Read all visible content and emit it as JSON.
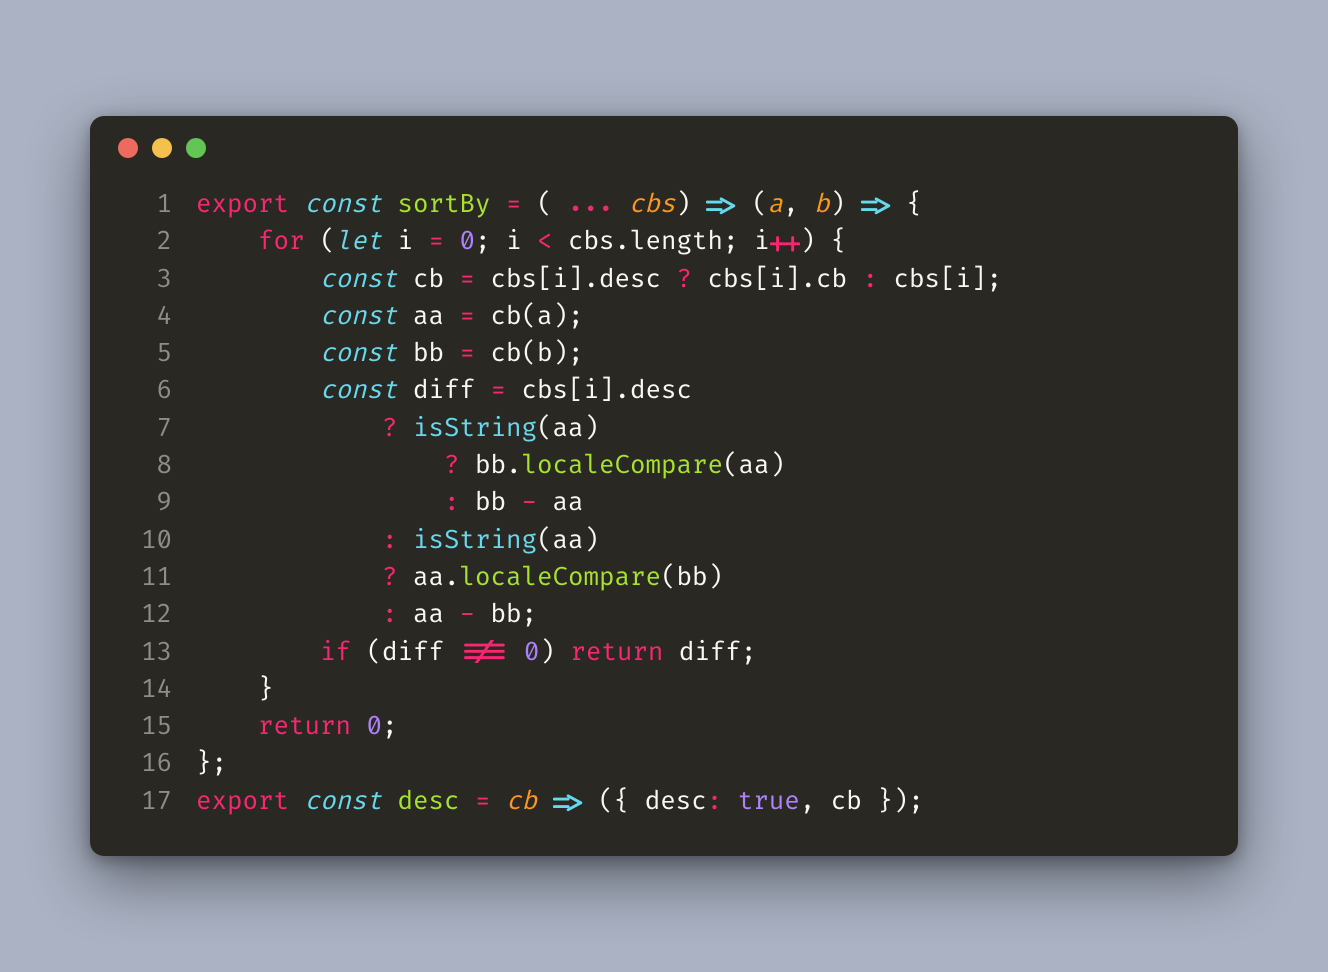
{
  "colors": {
    "page_bg": "#aab2c3",
    "window_bg": "#2a2822",
    "gutter": "#8d8f87",
    "text": "#f9f8f5",
    "keyword": "#f92672",
    "decl": "#66d9ef",
    "ident_decl": "#a6e22e",
    "param": "#fd971f",
    "number": "#ae81ff",
    "method": "#a6e22e",
    "dot_red": "#ed6a5e",
    "dot_yellow": "#f5c04e",
    "dot_green": "#62c554"
  },
  "code": {
    "lines": [
      {
        "n": "1",
        "indent": 0,
        "tokens": [
          [
            "kw-export",
            "export"
          ],
          [
            "sp",
            " "
          ],
          [
            "kw-decl",
            "const"
          ],
          [
            "sp",
            " "
          ],
          [
            "ident-decl",
            "sortBy"
          ],
          [
            "sp",
            " "
          ],
          [
            "op-main",
            "="
          ],
          [
            "sp",
            " "
          ],
          [
            "punct",
            "("
          ],
          [
            "sp",
            " "
          ],
          [
            "spread"
          ],
          [
            "sp",
            " "
          ],
          [
            "param",
            "cbs"
          ],
          [
            "punct",
            ")"
          ],
          [
            "sp",
            " "
          ],
          [
            "arrow"
          ],
          [
            "sp",
            " "
          ],
          [
            "punct",
            "("
          ],
          [
            "param",
            "a"
          ],
          [
            "punct",
            ","
          ],
          [
            "sp",
            " "
          ],
          [
            "param",
            "b"
          ],
          [
            "punct",
            ")"
          ],
          [
            "sp",
            " "
          ],
          [
            "arrow"
          ],
          [
            "sp",
            " "
          ],
          [
            "punct",
            "{"
          ]
        ]
      },
      {
        "n": "2",
        "indent": 1,
        "tokens": [
          [
            "kw-export",
            "for"
          ],
          [
            "sp",
            " "
          ],
          [
            "punct",
            "("
          ],
          [
            "kw-decl",
            "let"
          ],
          [
            "sp",
            " "
          ],
          [
            "var",
            "i"
          ],
          [
            "sp",
            " "
          ],
          [
            "op-main",
            "="
          ],
          [
            "sp",
            " "
          ],
          [
            "num",
            "0"
          ],
          [
            "punct",
            ";"
          ],
          [
            "sp",
            " "
          ],
          [
            "var",
            "i"
          ],
          [
            "sp",
            " "
          ],
          [
            "op-main",
            "<"
          ],
          [
            "sp",
            " "
          ],
          [
            "var",
            "cbs"
          ],
          [
            "punct",
            "."
          ],
          [
            "var",
            "length"
          ],
          [
            "punct",
            ";"
          ],
          [
            "sp",
            " "
          ],
          [
            "var",
            "i"
          ],
          [
            "pp"
          ],
          [
            "punct",
            ")"
          ],
          [
            "sp",
            " "
          ],
          [
            "punct",
            "{"
          ]
        ]
      },
      {
        "n": "3",
        "indent": 2,
        "tokens": [
          [
            "kw-decl",
            "const"
          ],
          [
            "sp",
            " "
          ],
          [
            "var",
            "cb"
          ],
          [
            "sp",
            " "
          ],
          [
            "op-main",
            "="
          ],
          [
            "sp",
            " "
          ],
          [
            "var",
            "cbs"
          ],
          [
            "punct",
            "["
          ],
          [
            "var",
            "i"
          ],
          [
            "punct",
            "]"
          ],
          [
            "punct",
            "."
          ],
          [
            "var",
            "desc"
          ],
          [
            "sp",
            " "
          ],
          [
            "op-main",
            "?"
          ],
          [
            "sp",
            " "
          ],
          [
            "var",
            "cbs"
          ],
          [
            "punct",
            "["
          ],
          [
            "var",
            "i"
          ],
          [
            "punct",
            "]"
          ],
          [
            "punct",
            "."
          ],
          [
            "var",
            "cb"
          ],
          [
            "sp",
            " "
          ],
          [
            "op-main",
            ":"
          ],
          [
            "sp",
            " "
          ],
          [
            "var",
            "cbs"
          ],
          [
            "punct",
            "["
          ],
          [
            "var",
            "i"
          ],
          [
            "punct",
            "]"
          ],
          [
            "punct",
            ";"
          ]
        ]
      },
      {
        "n": "4",
        "indent": 2,
        "tokens": [
          [
            "kw-decl",
            "const"
          ],
          [
            "sp",
            " "
          ],
          [
            "var",
            "aa"
          ],
          [
            "sp",
            " "
          ],
          [
            "op-main",
            "="
          ],
          [
            "sp",
            " "
          ],
          [
            "var",
            "cb"
          ],
          [
            "punct",
            "("
          ],
          [
            "var",
            "a"
          ],
          [
            "punct",
            ")"
          ],
          [
            "punct",
            ";"
          ]
        ]
      },
      {
        "n": "5",
        "indent": 2,
        "tokens": [
          [
            "kw-decl",
            "const"
          ],
          [
            "sp",
            " "
          ],
          [
            "var",
            "bb"
          ],
          [
            "sp",
            " "
          ],
          [
            "op-main",
            "="
          ],
          [
            "sp",
            " "
          ],
          [
            "var",
            "cb"
          ],
          [
            "punct",
            "("
          ],
          [
            "var",
            "b"
          ],
          [
            "punct",
            ")"
          ],
          [
            "punct",
            ";"
          ]
        ]
      },
      {
        "n": "6",
        "indent": 2,
        "tokens": [
          [
            "kw-decl",
            "const"
          ],
          [
            "sp",
            " "
          ],
          [
            "var",
            "diff"
          ],
          [
            "sp",
            " "
          ],
          [
            "op-main",
            "="
          ],
          [
            "sp",
            " "
          ],
          [
            "var",
            "cbs"
          ],
          [
            "punct",
            "["
          ],
          [
            "var",
            "i"
          ],
          [
            "punct",
            "]"
          ],
          [
            "punct",
            "."
          ],
          [
            "var",
            "desc"
          ]
        ]
      },
      {
        "n": "7",
        "indent": 3,
        "tokens": [
          [
            "op-main",
            "?"
          ],
          [
            "sp",
            " "
          ],
          [
            "call",
            "isString"
          ],
          [
            "punct",
            "("
          ],
          [
            "var",
            "aa"
          ],
          [
            "punct",
            ")"
          ]
        ]
      },
      {
        "n": "8",
        "indent": 4,
        "tokens": [
          [
            "op-main",
            "?"
          ],
          [
            "sp",
            " "
          ],
          [
            "var",
            "bb"
          ],
          [
            "punct",
            "."
          ],
          [
            "method",
            "localeCompare"
          ],
          [
            "punct",
            "("
          ],
          [
            "var",
            "aa"
          ],
          [
            "punct",
            ")"
          ]
        ]
      },
      {
        "n": "9",
        "indent": 4,
        "tokens": [
          [
            "op-main",
            ":"
          ],
          [
            "sp",
            " "
          ],
          [
            "var",
            "bb"
          ],
          [
            "sp",
            " "
          ],
          [
            "op-main",
            "-"
          ],
          [
            "sp",
            " "
          ],
          [
            "var",
            "aa"
          ]
        ]
      },
      {
        "n": "10",
        "indent": 3,
        "tokens": [
          [
            "op-main",
            ":"
          ],
          [
            "sp",
            " "
          ],
          [
            "call",
            "isString"
          ],
          [
            "punct",
            "("
          ],
          [
            "var",
            "aa"
          ],
          [
            "punct",
            ")"
          ]
        ]
      },
      {
        "n": "11",
        "indent": 3,
        "tokens": [
          [
            "op-main",
            "?"
          ],
          [
            "sp",
            " "
          ],
          [
            "var",
            "aa"
          ],
          [
            "punct",
            "."
          ],
          [
            "method",
            "localeCompare"
          ],
          [
            "punct",
            "("
          ],
          [
            "var",
            "bb"
          ],
          [
            "punct",
            ")"
          ]
        ]
      },
      {
        "n": "12",
        "indent": 3,
        "tokens": [
          [
            "op-main",
            ":"
          ],
          [
            "sp",
            " "
          ],
          [
            "var",
            "aa"
          ],
          [
            "sp",
            " "
          ],
          [
            "op-main",
            "-"
          ],
          [
            "sp",
            " "
          ],
          [
            "var",
            "bb"
          ],
          [
            "punct",
            ";"
          ]
        ]
      },
      {
        "n": "13",
        "indent": 2,
        "tokens": [
          [
            "kw-export",
            "if"
          ],
          [
            "sp",
            " "
          ],
          [
            "punct",
            "("
          ],
          [
            "var",
            "diff"
          ],
          [
            "sp",
            " "
          ],
          [
            "neq"
          ],
          [
            "sp",
            " "
          ],
          [
            "num",
            "0"
          ],
          [
            "punct",
            ")"
          ],
          [
            "sp",
            " "
          ],
          [
            "kw-export",
            "return"
          ],
          [
            "sp",
            " "
          ],
          [
            "var",
            "diff"
          ],
          [
            "punct",
            ";"
          ]
        ]
      },
      {
        "n": "14",
        "indent": 1,
        "tokens": [
          [
            "punct",
            "}"
          ]
        ]
      },
      {
        "n": "15",
        "indent": 1,
        "tokens": [
          [
            "kw-export",
            "return"
          ],
          [
            "sp",
            " "
          ],
          [
            "num",
            "0"
          ],
          [
            "punct",
            ";"
          ]
        ]
      },
      {
        "n": "16",
        "indent": 0,
        "tokens": [
          [
            "punct",
            "}"
          ],
          [
            "punct",
            ";"
          ]
        ]
      },
      {
        "n": "17",
        "indent": 0,
        "tokens": [
          [
            "kw-export",
            "export"
          ],
          [
            "sp",
            " "
          ],
          [
            "kw-decl",
            "const"
          ],
          [
            "sp",
            " "
          ],
          [
            "ident-decl",
            "desc"
          ],
          [
            "sp",
            " "
          ],
          [
            "op-main",
            "="
          ],
          [
            "sp",
            " "
          ],
          [
            "param",
            "cb"
          ],
          [
            "sp",
            " "
          ],
          [
            "arrow"
          ],
          [
            "sp",
            " "
          ],
          [
            "punct",
            "("
          ],
          [
            "punct",
            "{"
          ],
          [
            "sp",
            " "
          ],
          [
            "var",
            "desc"
          ],
          [
            "op-main",
            ":"
          ],
          [
            "sp",
            " "
          ],
          [
            "num",
            "true"
          ],
          [
            "punct",
            ","
          ],
          [
            "sp",
            " "
          ],
          [
            "var",
            "cb"
          ],
          [
            "sp",
            " "
          ],
          [
            "punct",
            "}"
          ],
          [
            "punct",
            ")"
          ],
          [
            "punct",
            ";"
          ]
        ]
      }
    ]
  }
}
